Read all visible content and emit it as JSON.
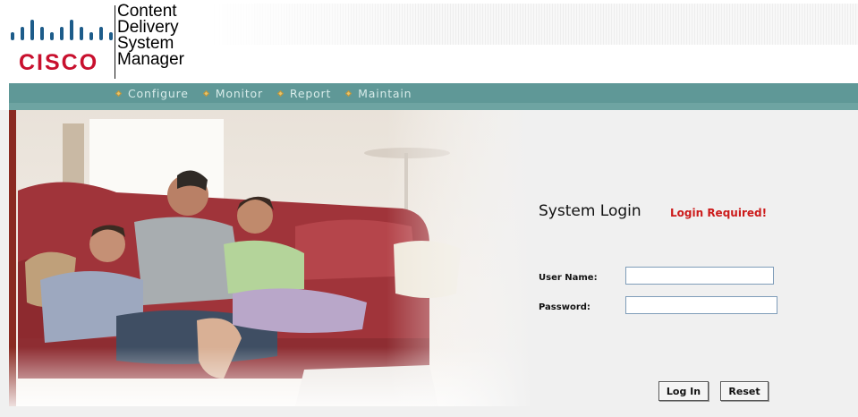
{
  "header": {
    "brand": "CISCO",
    "product_lines": [
      "Content",
      "Delivery",
      "System",
      "Manager"
    ],
    "logo_icon": "cisco-bars-logo",
    "brand_color": "#c8102e",
    "logo_bar_color": "#1d5c8a"
  },
  "nav": {
    "items": [
      {
        "label": "Configure"
      },
      {
        "label": "Monitor"
      },
      {
        "label": "Report"
      },
      {
        "label": "Maintain"
      }
    ],
    "bar_color": "#5f9897",
    "text_color": "#d7ebe9",
    "bullet_color": "#e5c46a"
  },
  "login": {
    "title": "System Login",
    "status": "Login Required!",
    "status_color": "#cc1b1b",
    "username_label": "User Name:",
    "username_value": "",
    "password_label": "Password:",
    "password_value": "",
    "login_button": "Log In",
    "reset_button": "Reset"
  },
  "photo": {
    "subject": "family-on-couch-photo"
  }
}
